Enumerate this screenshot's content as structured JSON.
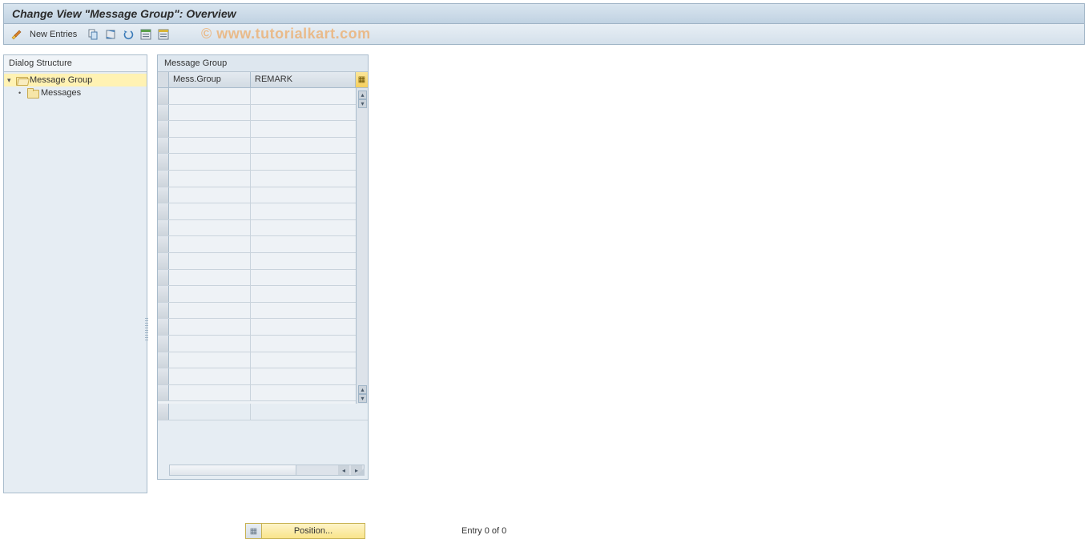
{
  "title": "Change View \"Message Group\": Overview",
  "toolbar": {
    "new_entries_label": "New Entries"
  },
  "watermark": "© www.tutorialkart.com",
  "tree": {
    "header": "Dialog Structure",
    "items": [
      {
        "label": "Message Group",
        "icon": "folder-open",
        "selected": true,
        "level": 0,
        "expandable": true
      },
      {
        "label": "Messages",
        "icon": "folder",
        "selected": false,
        "level": 1,
        "expandable": false
      }
    ]
  },
  "table": {
    "title": "Message Group",
    "columns": [
      {
        "key": "mess_group",
        "label": "Mess.Group"
      },
      {
        "key": "remark",
        "label": "REMARK"
      }
    ],
    "rows_visible": 19,
    "rows": []
  },
  "footer": {
    "position_label": "Position...",
    "entry_text": "Entry 0 of 0"
  }
}
